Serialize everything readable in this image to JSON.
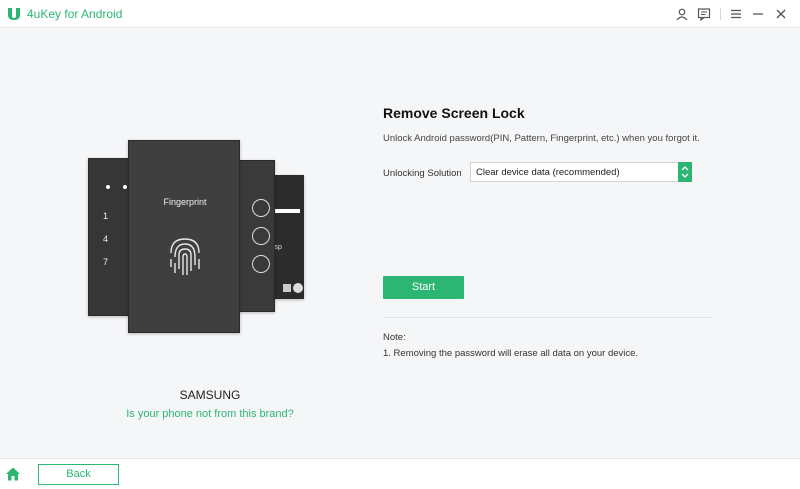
{
  "app": {
    "title": "4uKey for Android"
  },
  "titlebar": {
    "icons": [
      "user-icon",
      "feedback-icon",
      "menu-icon",
      "minimize-icon",
      "close-icon"
    ]
  },
  "illustration": {
    "fingerprint_label": "Fingerprint",
    "keypad_digits": [
      "1",
      "4",
      "7"
    ],
    "right_phone_text": "uisp"
  },
  "brand": {
    "name": "SAMSUNG",
    "link": "Is your phone not from this brand?"
  },
  "content": {
    "title": "Remove Screen Lock",
    "description": "Unlock Android password(PIN, Pattern, Fingerprint, etc.) when you forgot it.",
    "solution_label": "Unlocking Solution",
    "solution_value": "Clear device data (recommended)",
    "start_label": "Start",
    "note_title": "Note:",
    "note_item": "1. Removing the password will erase all data on your device."
  },
  "footer": {
    "back_label": "Back"
  },
  "colors": {
    "accent": "#2bb673",
    "background": "#f5f6f8"
  }
}
